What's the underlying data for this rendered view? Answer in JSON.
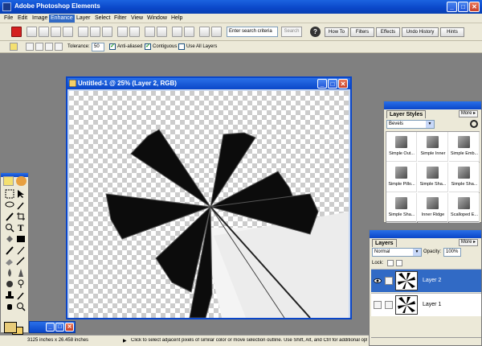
{
  "app": {
    "title": "Adobe Photoshop Elements"
  },
  "window_buttons": {
    "minimize": "_",
    "maximize": "□",
    "close": "✕"
  },
  "menu": {
    "items": [
      "File",
      "Edit",
      "Image",
      "Enhance",
      "Layer",
      "Select",
      "Filter",
      "View",
      "Window",
      "Help"
    ],
    "active": "Enhance"
  },
  "toolbar": {
    "search_placeholder": "Enter search criteria",
    "search_button": "Search",
    "help_icon": "?",
    "palette_tabs": [
      "How To",
      "Filters",
      "Effects",
      "Undo History",
      "Hints"
    ]
  },
  "options": {
    "tolerance_label": "Tolerance:",
    "tolerance_value": "50",
    "anti_aliased": {
      "label": "Anti-aliased",
      "checked": true
    },
    "contiguous": {
      "label": "Contiguous",
      "checked": true
    },
    "use_all_layers": {
      "label": "Use All Layers",
      "checked": false
    }
  },
  "document": {
    "title": "Untitled-1 @ 25% (Layer 2, RGB)"
  },
  "layer_styles": {
    "tab": "Layer Styles",
    "more": "More ▸",
    "category": "Bevels",
    "styles": [
      "Simple Out...",
      "Simple Inner",
      "Simple Emb...",
      "Simple Pillo...",
      "Simple Sha...",
      "Simple Sha...",
      "Simple Sha...",
      "Inner Ridge",
      "Scalloped E..."
    ]
  },
  "layers": {
    "tab": "Layers",
    "more": "More ▸",
    "blend_mode": "Normal",
    "opacity_label": "Opacity:",
    "opacity_value": "100%",
    "lock_label": "Lock:",
    "items": [
      {
        "name": "Layer 2",
        "selected": true
      },
      {
        "name": "Layer 1",
        "selected": false
      }
    ]
  },
  "status": {
    "dimensions": "3125 inches x 26.458 inches",
    "hint": "Click to select adjacent pixels of similar color or move selection outline. Use Shift, Alt, and Ctrl for additional options."
  },
  "colors": {
    "accent": "#0a46c8",
    "selection": "#316ac5",
    "foreground": "#e8cc7a",
    "background": "#f4d068"
  }
}
